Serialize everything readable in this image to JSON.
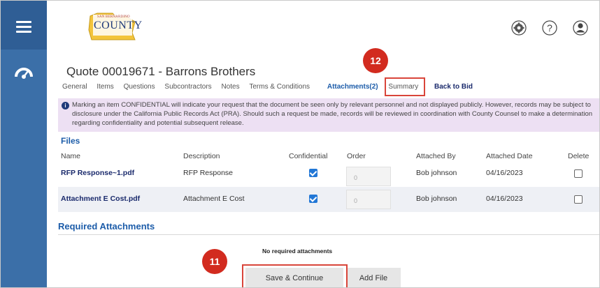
{
  "header": {
    "logo_small": "SAN BERNARDINO",
    "logo_big": "COUNTY"
  },
  "quote": {
    "title": "Quote 00019671 - Barrons Brothers"
  },
  "tabs": [
    {
      "label": "General"
    },
    {
      "label": "Items"
    },
    {
      "label": "Questions"
    },
    {
      "label": "Subcontractors"
    },
    {
      "label": "Notes"
    },
    {
      "label": "Terms & Conditions"
    },
    {
      "label": "Attachments(2)"
    },
    {
      "label": "Summary"
    },
    {
      "label": "Back to Bid"
    }
  ],
  "notice": {
    "text": "Marking an item CONFIDENTIAL will indicate your request that the document be seen only by relevant personnel and not displayed publicly. However, records may be subject to disclosure under the California Public Records Act (PRA). Should such a request be made, records will be reviewed in coordination with County Counsel to make a determination regarding confidentiality and potential subsequent release."
  },
  "files": {
    "heading": "Files",
    "columns": [
      "Name",
      "Description",
      "Confidential",
      "Order",
      "Attached By",
      "Attached Date",
      "Delete"
    ],
    "rows": [
      {
        "name": "RFP Response~1.pdf",
        "description": "RFP Response",
        "confidential": true,
        "order": "0",
        "attached_by": "Bob johnson",
        "attached_date": "04/16/2023",
        "delete": false
      },
      {
        "name": "Attachment E Cost.pdf",
        "description": "Attachment E Cost",
        "confidential": true,
        "order": "0",
        "attached_by": "Bob johnson",
        "attached_date": "04/16/2023",
        "delete": false
      }
    ]
  },
  "required": {
    "heading": "Required Attachments",
    "empty_text": "No required attachments"
  },
  "buttons": {
    "save_continue": "Save & Continue",
    "add_file": "Add File"
  },
  "callouts": {
    "badge_12": "12",
    "badge_11": "11"
  },
  "colors": {
    "rail": "#3b6fa8",
    "accent": "#1c5ca9",
    "callout": "#d22b1f",
    "notice_bg": "#ede0f3"
  }
}
